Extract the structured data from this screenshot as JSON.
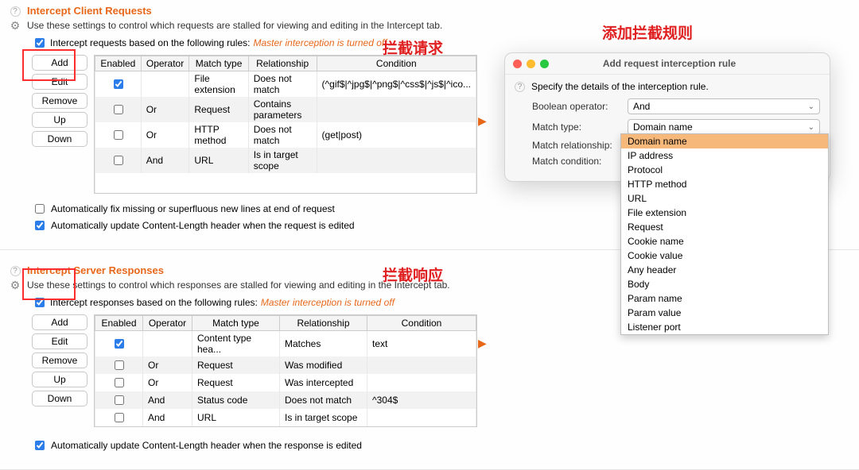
{
  "annotations": {
    "a1": "拦截请求",
    "a2": "添加拦截规则",
    "a3": "拦截响应"
  },
  "req": {
    "heading": "Intercept Client Requests",
    "sub": "Use these settings to control which requests are stalled for viewing and editing in the Intercept tab.",
    "ruleLabel": "Intercept requests based on the following rules:",
    "ruleWarn": "Master interception is turned off",
    "buttons": {
      "add": "Add",
      "edit": "Edit",
      "remove": "Remove",
      "up": "Up",
      "down": "Down"
    },
    "cols": {
      "enabled": "Enabled",
      "operator": "Operator",
      "match": "Match type",
      "rel": "Relationship",
      "cond": "Condition"
    },
    "rows": [
      {
        "enabled": true,
        "op": "",
        "match": "File extension",
        "rel": "Does not match",
        "cond": "(^gif$|^jpg$|^png$|^css$|^js$|^ico..."
      },
      {
        "enabled": false,
        "op": "Or",
        "match": "Request",
        "rel": "Contains parameters",
        "cond": ""
      },
      {
        "enabled": false,
        "op": "Or",
        "match": "HTTP method",
        "rel": "Does not match",
        "cond": "(get|post)"
      },
      {
        "enabled": false,
        "op": "And",
        "match": "URL",
        "rel": "Is in target scope",
        "cond": ""
      }
    ],
    "opt1": "Automatically fix missing or superfluous new lines at end of request",
    "opt2": "Automatically update Content-Length header when the request is edited"
  },
  "res": {
    "heading": "Intercept Server Responses",
    "sub": "Use these settings to control which responses are stalled for viewing and editing in the Intercept tab.",
    "ruleLabel": "Intercept responses based on the following rules:",
    "ruleWarn": "Master interception is turned off",
    "buttons": {
      "add": "Add",
      "edit": "Edit",
      "remove": "Remove",
      "up": "Up",
      "down": "Down"
    },
    "cols": {
      "enabled": "Enabled",
      "operator": "Operator",
      "match": "Match type",
      "rel": "Relationship",
      "cond": "Condition"
    },
    "rows": [
      {
        "enabled": true,
        "op": "",
        "match": "Content type hea...",
        "rel": "Matches",
        "cond": "text"
      },
      {
        "enabled": false,
        "op": "Or",
        "match": "Request",
        "rel": "Was modified",
        "cond": ""
      },
      {
        "enabled": false,
        "op": "Or",
        "match": "Request",
        "rel": "Was intercepted",
        "cond": ""
      },
      {
        "enabled": false,
        "op": "And",
        "match": "Status code",
        "rel": "Does not match",
        "cond": "^304$"
      },
      {
        "enabled": false,
        "op": "And",
        "match": "URL",
        "rel": "Is in target scope",
        "cond": ""
      }
    ],
    "opt1": "Automatically update Content-Length header when the response is edited"
  },
  "dialog": {
    "title": "Add request interception rule",
    "desc": "Specify the details of the interception rule.",
    "labels": {
      "bool": "Boolean operator:",
      "match": "Match type:",
      "rel": "Match relationship:",
      "cond": "Match condition:"
    },
    "values": {
      "bool": "And",
      "match": "Domain name"
    },
    "matchOptions": [
      "Domain name",
      "IP address",
      "Protocol",
      "HTTP method",
      "URL",
      "File extension",
      "Request",
      "Cookie name",
      "Cookie value",
      "Any header",
      "Body",
      "Param name",
      "Param value",
      "Listener port"
    ]
  }
}
